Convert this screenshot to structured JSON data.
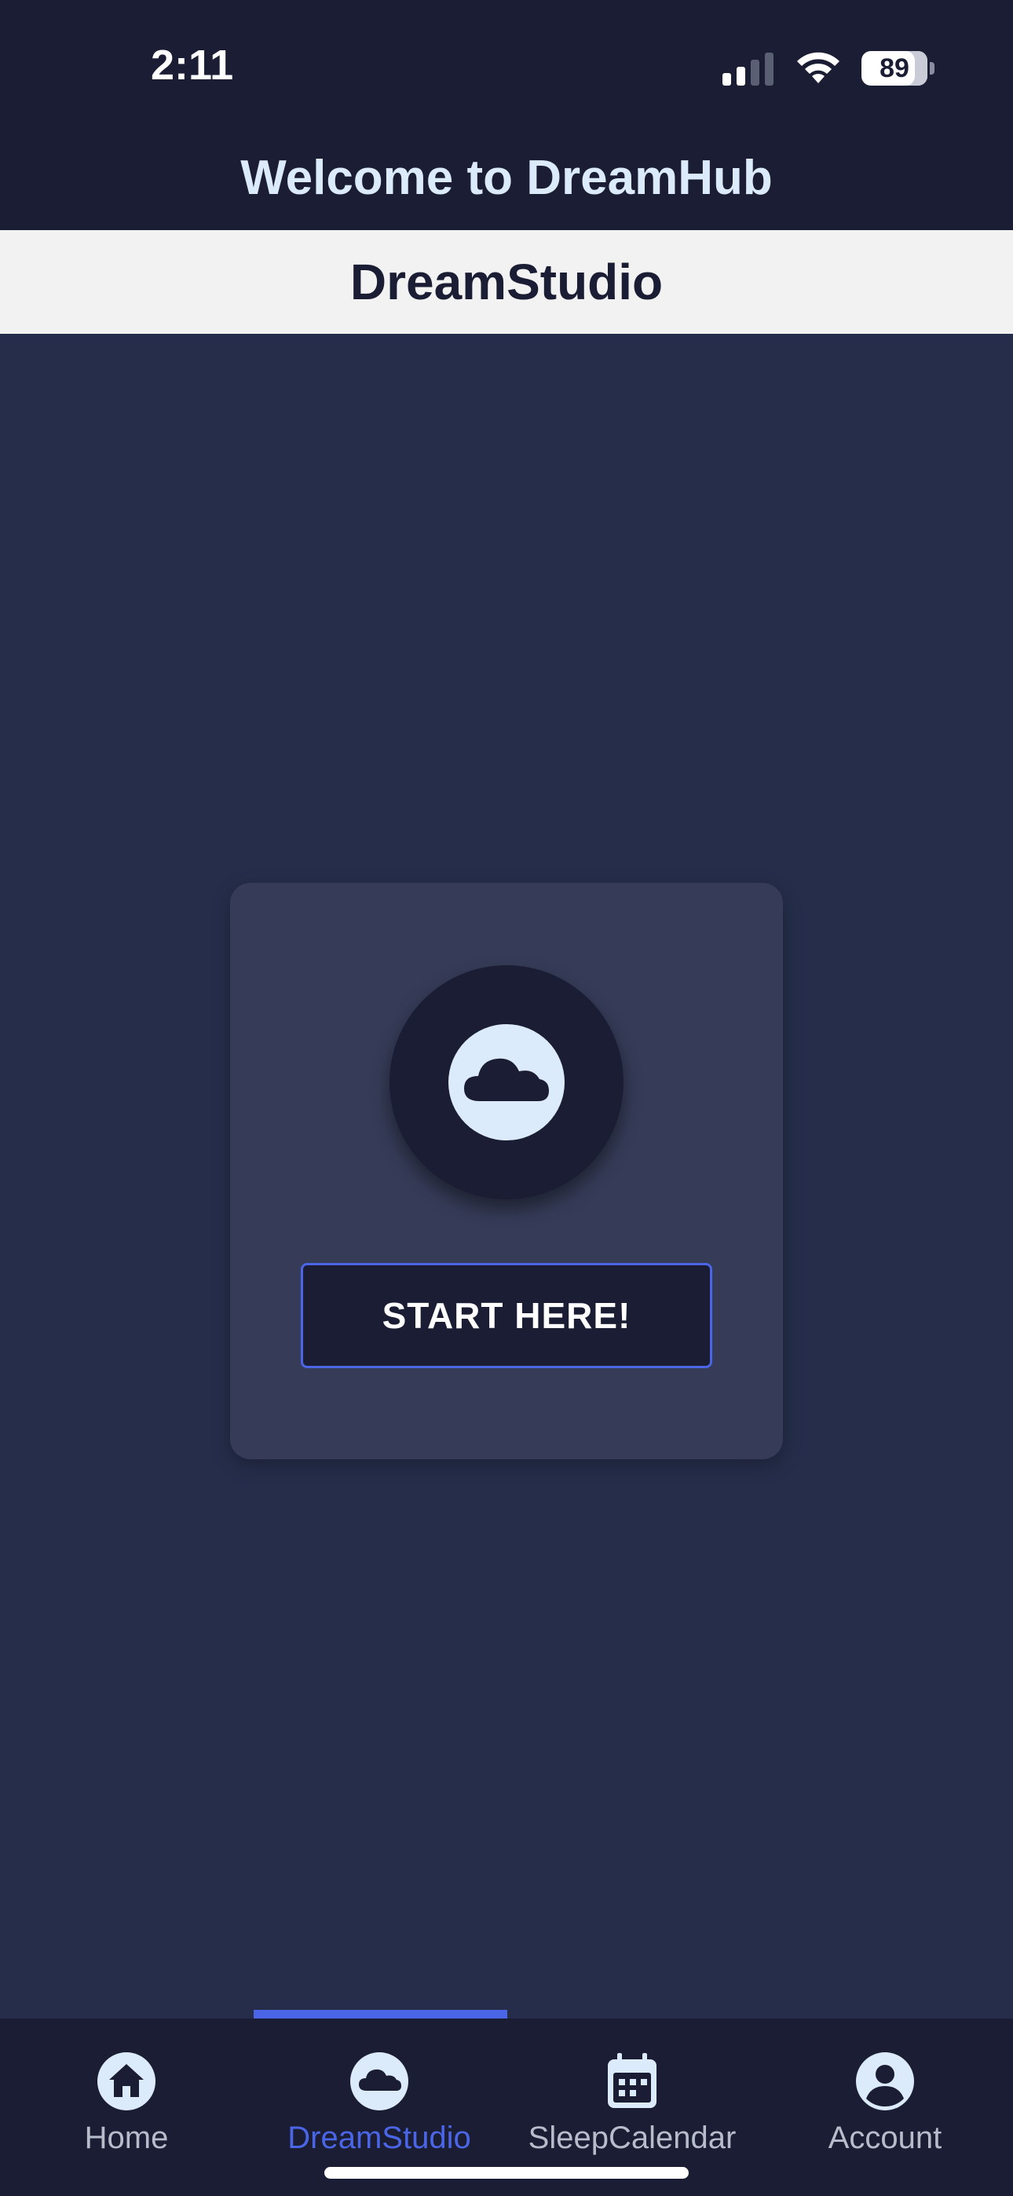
{
  "status_bar": {
    "time": "2:11",
    "battery": "89",
    "icons": [
      "signal-icon",
      "wifi-icon",
      "battery-icon"
    ]
  },
  "app_header": {
    "title": "Welcome to DreamHub"
  },
  "section_header": {
    "title": "DreamStudio"
  },
  "card": {
    "icon": "cloud-icon",
    "button_label": "START HERE!"
  },
  "tabs": [
    {
      "label": "Home",
      "icon": "home-icon",
      "active": false
    },
    {
      "label": "DreamStudio",
      "icon": "cloud-icon",
      "active": true
    },
    {
      "label": "SleepCalendar",
      "icon": "calendar-icon",
      "active": false
    },
    {
      "label": "Account",
      "icon": "account-icon",
      "active": false
    }
  ],
  "colors": {
    "background": "#252d4a",
    "header": "#1a1d33",
    "accent": "#4a66e6",
    "card": "#363c58",
    "light_icon": "#dcebfb"
  }
}
